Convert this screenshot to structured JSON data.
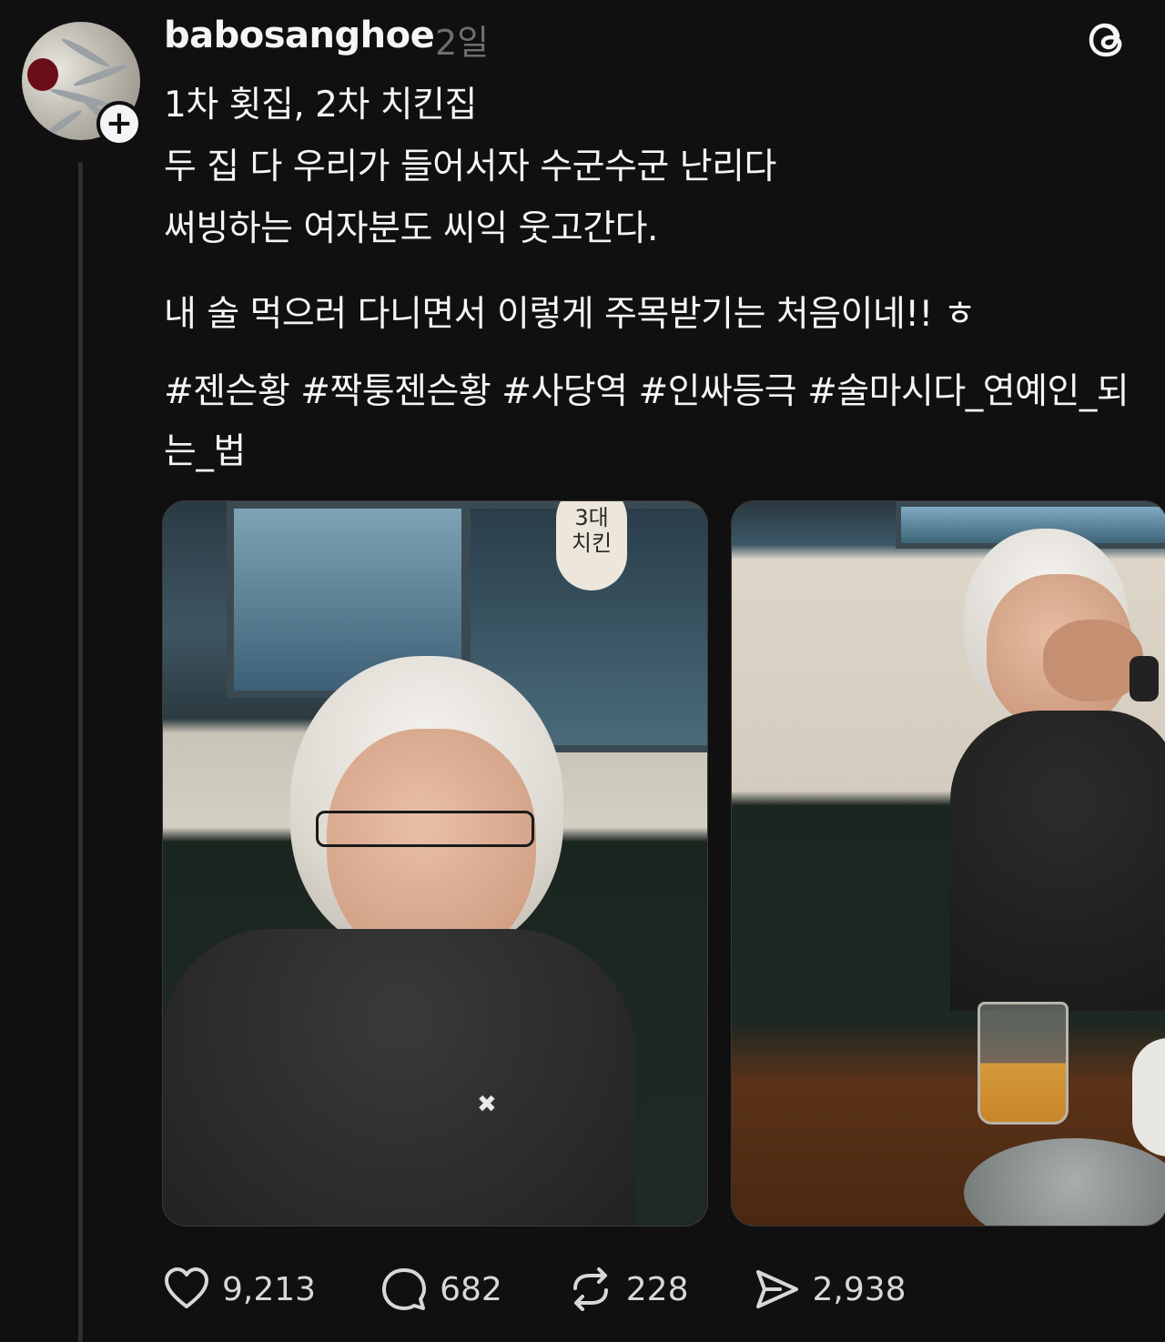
{
  "post": {
    "username": "babosanghoe",
    "time": "2일",
    "lines": [
      "1차 횟집, 2차 치킨집",
      "두 집 다 우리가 들어서자 수군수군 난리다",
      "써빙하는 여자분도 씨익 웃고간다."
    ],
    "line2": "내 술 먹으러 다니면서 이렇게 주목받기는 처음이네!! ㅎ",
    "hashtags": [
      "#젠슨황",
      "#짝퉁젠슨황",
      "#사당역",
      "#인싸등극",
      "#술마시다_연예인_되는_법"
    ]
  },
  "photos": {
    "photo1_sign": "3대\n치킨"
  },
  "actions": {
    "likes": "9,213",
    "comments": "682",
    "reposts": "228",
    "shares": "2,938"
  },
  "icons": {
    "avatar": "avatar-image",
    "follow": "plus-icon",
    "logo": "threads-logo-icon",
    "like": "heart-icon",
    "comment": "speech-bubble-icon",
    "repost": "repost-icon",
    "share": "send-icon"
  }
}
